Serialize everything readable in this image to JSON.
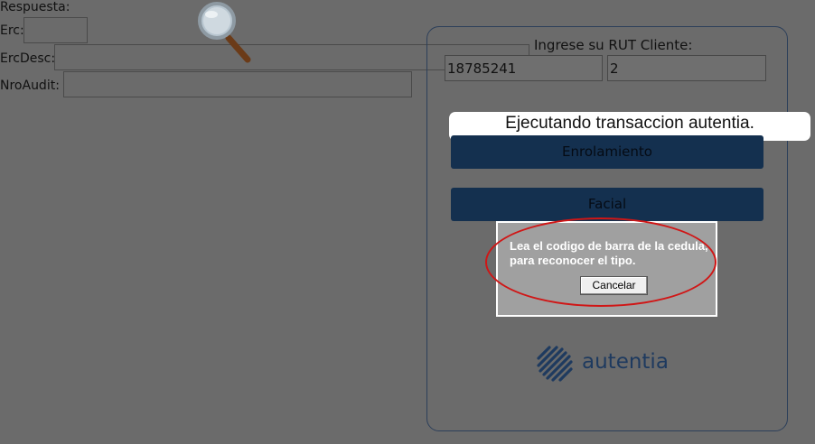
{
  "form": {
    "respuesta_label": "Respuesta:",
    "erc_label": "Erc:",
    "ercdesc_label": "ErcDesc:",
    "nroaudit_label": "NroAudit:"
  },
  "panel": {
    "rut_label": "Ingrese su RUT Cliente:",
    "rut_value": "18785241",
    "dv_value": "2",
    "status_toast": "Ejecutando transaccion autentia.",
    "enrolamiento_label": "Enrolamiento",
    "facial_label": "Facial",
    "logo_text": "autentia",
    "brand_color": "#1e3a5f"
  },
  "dialog": {
    "message": "Lea el codigo de barra de la cedula, para reconocer el tipo.",
    "cancel_label": "Cancelar"
  },
  "overlay": {
    "magnifier": "magnifier-icon",
    "highlight": "red-ellipse-annotation"
  }
}
